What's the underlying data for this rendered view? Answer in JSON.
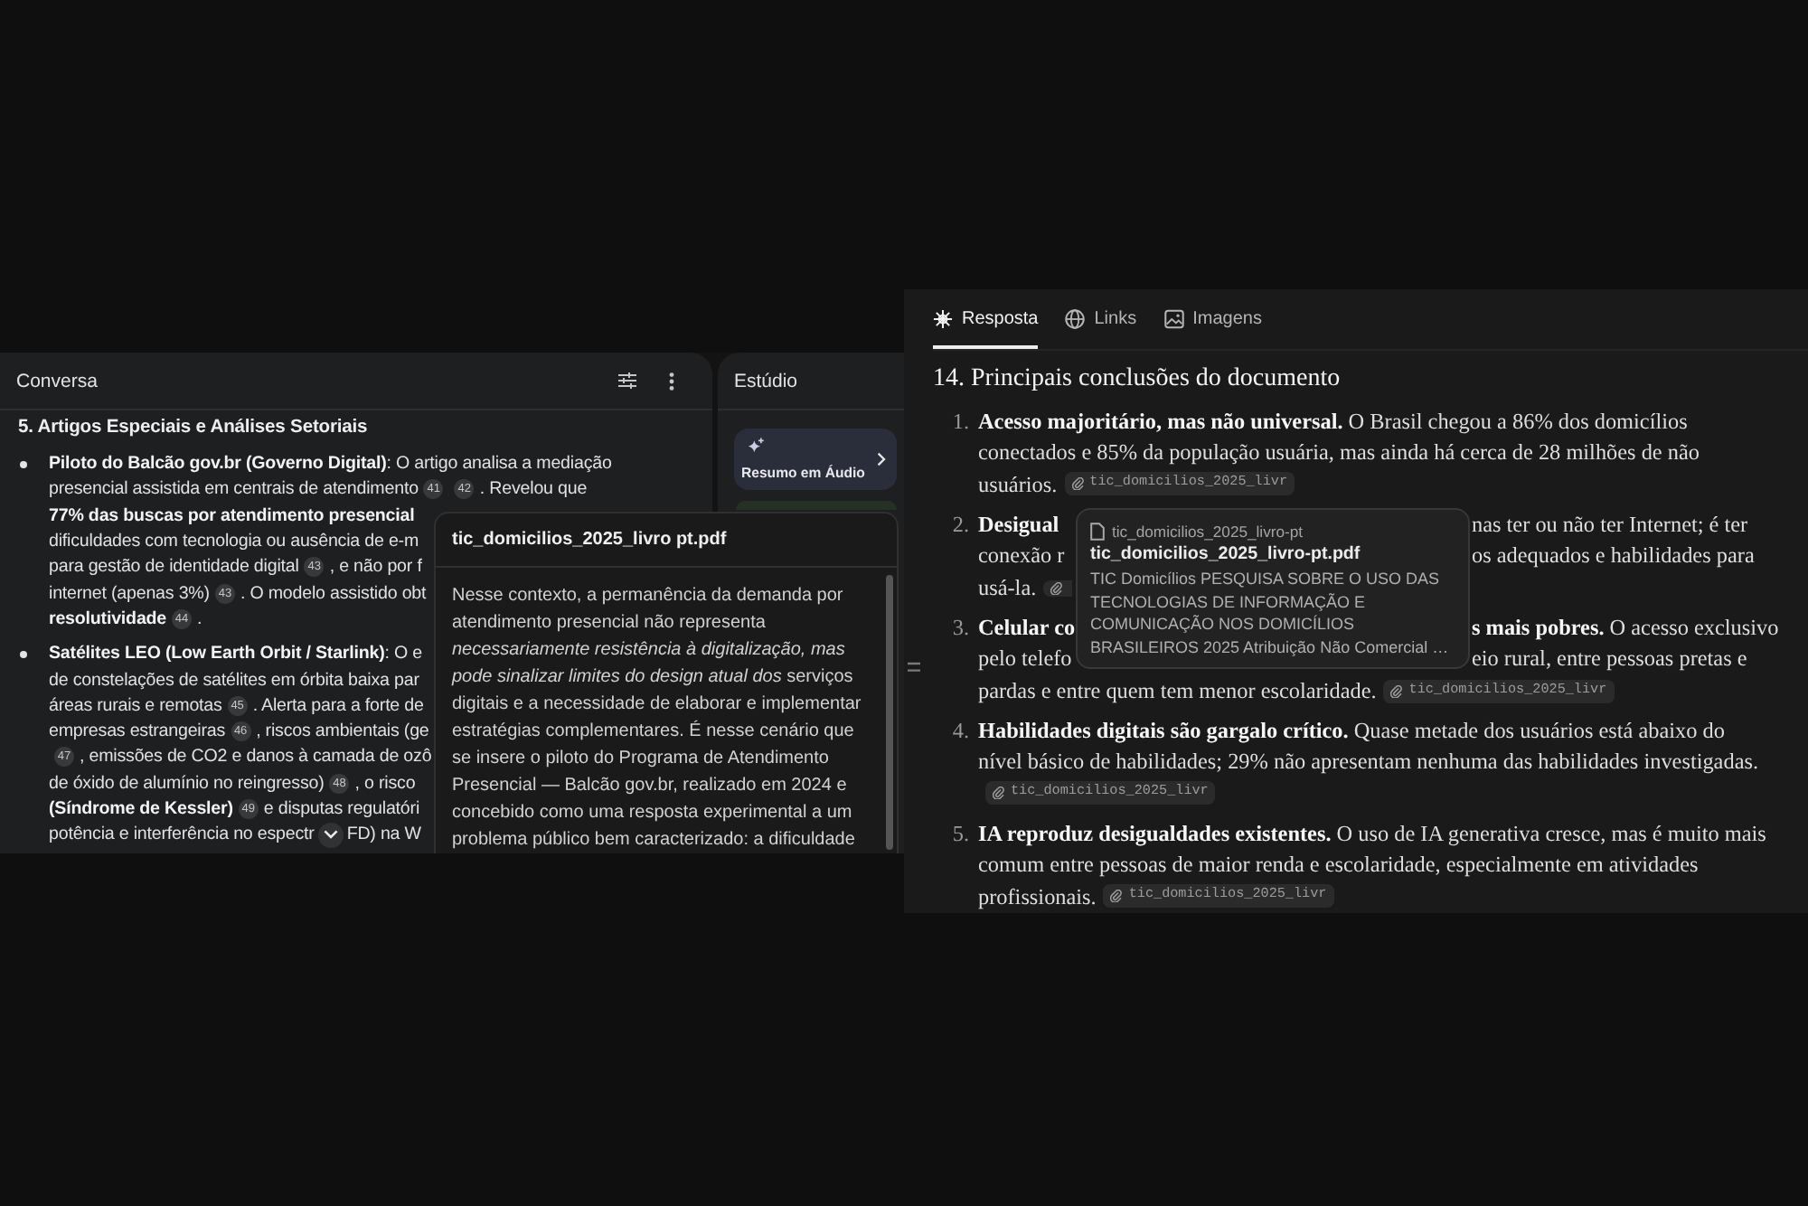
{
  "conversation": {
    "title": "Conversa",
    "heading": "5. Artigos Especiais e Análises Setoriais",
    "bullets": [
      {
        "lines": [
          [
            {
              "kind": "text",
              "text": "**Piloto do Balcão gov.br (Governo Digital)**: O artigo analisa a mediação"
            }
          ],
          [
            {
              "kind": "text",
              "text": "presencial assistida em centrais de atendimento"
            },
            {
              "kind": "cite",
              "text": "41"
            },
            {
              "kind": "cite",
              "text": "42"
            },
            {
              "kind": "text",
              "text": ". Revelou que"
            }
          ],
          [
            {
              "kind": "strong",
              "text": "77% das buscas por atendimento presencial"
            }
          ],
          [
            {
              "kind": "text",
              "text": "dificuldades com tecnologia ou ausência de e-m"
            }
          ],
          [
            {
              "kind": "text",
              "text": "para gestão de identidade digital"
            },
            {
              "kind": "cite",
              "text": "43"
            },
            {
              "kind": "text",
              "text": ", e não por f"
            }
          ],
          [
            {
              "kind": "text",
              "text": "internet (apenas 3%)"
            },
            {
              "kind": "cite",
              "text": "43"
            },
            {
              "kind": "text",
              "text": ". O modelo assistido obt"
            }
          ],
          [
            {
              "kind": "strong",
              "text": "resolutividade"
            },
            {
              "kind": "cite",
              "text": "44"
            },
            {
              "kind": "text",
              "text": "."
            }
          ]
        ]
      },
      {
        "lines": [
          [
            {
              "kind": "text",
              "text": "**Satélites LEO (Low Earth Orbit / Starlink)**: O e"
            }
          ],
          [
            {
              "kind": "text",
              "text": "de constelações de satélites em órbita baixa par"
            }
          ],
          [
            {
              "kind": "text",
              "text": "áreas rurais e remotas"
            },
            {
              "kind": "cite",
              "text": "45"
            },
            {
              "kind": "text",
              "text": ". Alerta para a forte de"
            }
          ],
          [
            {
              "kind": "text",
              "text": "empresas estrangeiras"
            },
            {
              "kind": "cite",
              "text": "46"
            },
            {
              "kind": "text",
              "text": ", riscos ambientais (ge"
            }
          ],
          [
            {
              "kind": "cite",
              "text": "47"
            },
            {
              "kind": "text",
              "text": ", emissões de CO2 e danos à camada de ozô"
            }
          ],
          [
            {
              "kind": "text",
              "text": "de óxido de alumínio no reingresso)"
            },
            {
              "kind": "cite",
              "text": "48"
            },
            {
              "kind": "text",
              "text": ", o risco"
            }
          ],
          [
            {
              "kind": "strong",
              "text": "(Síndrome de Kessler)"
            },
            {
              "kind": "cite",
              "text": "49"
            },
            {
              "kind": "text",
              "text": "e disputas regulatóri"
            }
          ],
          [
            {
              "kind": "text",
              "text": "potência e interferência no espectr"
            },
            {
              "kind": "scroll_button"
            },
            {
              "kind": "text",
              "text": "FD) na W"
            }
          ]
        ]
      }
    ]
  },
  "studio": {
    "title": "Estúdio",
    "cards": [
      {
        "label": "Resumo em Áudio"
      }
    ]
  },
  "source_popover": {
    "title": "tic_domicilios_2025_livro pt.pdf",
    "body": "Nesse contexto, a permanência da demanda por atendimento presencial não representa *necessariamente resistência à digitalização, mas pode sinalizar limites do design atual dos* serviços digitais e a necessidade de elaborar e implementar estratégias complementares. É nesse cenário que se insere o piloto do Programa de Atendimento Presencial — Balcão gov.br, realizado em 2024 e concebido como uma resposta experimental a um problema público bem caracterizado: a dificuldade"
  },
  "answer": {
    "tabs": [
      {
        "label": "Resposta",
        "selected": true
      },
      {
        "label": "Links",
        "selected": false
      },
      {
        "label": "Imagens",
        "selected": false
      }
    ],
    "heading": "14. Principais conclusões do documento",
    "items": [
      {
        "kind": "paragraph",
        "number": "1.",
        "text": "**Acesso majoritário, mas não universal.** O Brasil chegou a 86% dos domicílios conectados e 85% da população usuária, mas ainda há cerca de 28 milhões de não usuários.",
        "source": "tic_domicilios_2025_livr"
      },
      {
        "kind": "split",
        "number": "2.",
        "lines": [
          {
            "left": [
              {
                "kind": "strong",
                "text": "Desigual"
              }
            ],
            "right": [
              {
                "kind": "text",
                "text": "nas ter ou não ter Internet; é ter"
              }
            ]
          },
          {
            "left": [
              {
                "kind": "text",
                "text": "conexão r"
              }
            ],
            "right": [
              {
                "kind": "text",
                "text": "os adequados e habilidades para"
              }
            ]
          },
          {
            "left": [
              {
                "kind": "text",
                "text": "usá-la."
              },
              {
                "kind": "chip"
              }
            ]
          }
        ]
      },
      {
        "kind": "split",
        "number": "3.",
        "lines": [
          {
            "left": [
              {
                "kind": "strong",
                "text": "Celular co"
              }
            ],
            "right": [
              {
                "kind": "text",
                "text": "**s mais pobres.** O acesso exclusivo"
              }
            ]
          },
          {
            "left": [
              {
                "kind": "text",
                "text": "pelo telefo"
              }
            ],
            "right": [
              {
                "kind": "text",
                "text": "eio rural, entre pessoas pretas e"
              }
            ]
          },
          {
            "left": [
              {
                "kind": "text",
                "text": "pardas e entre quem tem menor escolaridade."
              },
              {
                "kind": "chip",
                "text": "tic_domicilios_2025_livr"
              }
            ]
          }
        ]
      },
      {
        "kind": "paragraph",
        "number": "4.",
        "text": "**Habilidades digitais são gargalo crítico.** Quase metade dos usuários está abaixo do nível básico de habilidades; 29% não apresentam nenhuma das habilidades investigadas.",
        "source": "tic_domicilios_2025_livr"
      },
      {
        "kind": "paragraph",
        "number": "5.",
        "text": "**IA reproduz desigualdades existentes.** O uso de IA generativa cresce, mas é muito mais comum entre pessoas de maior renda e escolaridade, especialmente em atividades profissionais.",
        "source": "tic_domicilios_2025_livr"
      }
    ],
    "hover_card": {
      "source": "tic_domicilios_2025_livro-pt",
      "title": "tic_domicilios_2025_livro-pt.pdf",
      "description": "TIC Domicílios PESQUISA SOBRE O USO DAS TECNOLOGIAS DE INFORMAÇÃO E COMUNICAÇÃO NOS DOMICÍLIOS BRASILEIROS 2025 Atribuição Não Comercial …"
    }
  }
}
